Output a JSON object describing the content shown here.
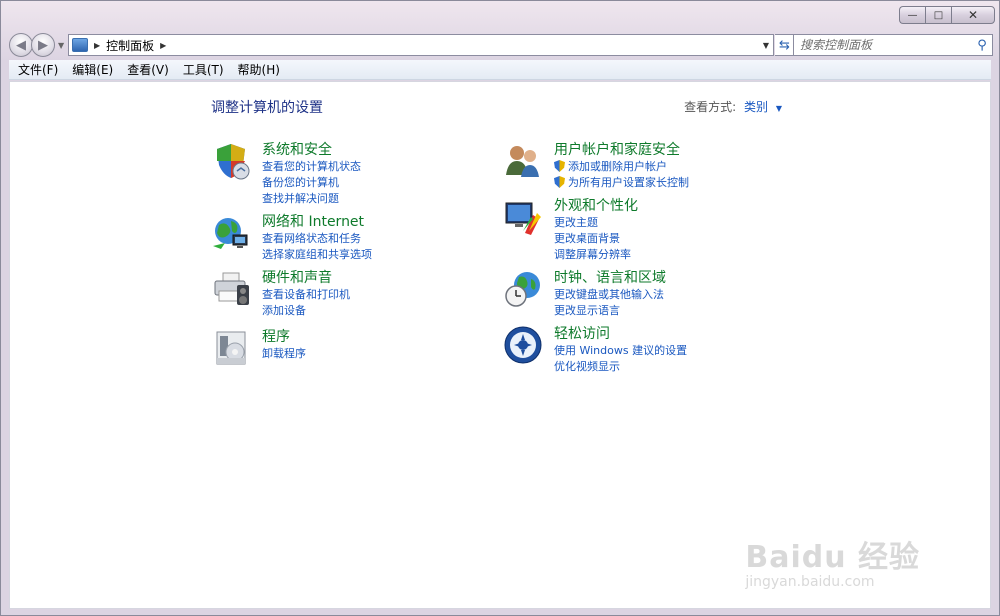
{
  "window": {
    "caption": {
      "minimize_glyph": "—",
      "maximize_glyph": "□",
      "close_glyph": "✕"
    }
  },
  "address": {
    "path": "控制面板",
    "icon": "control-panel-icon"
  },
  "search": {
    "placeholder": "搜索控制面板"
  },
  "menu": [
    {
      "label": "文件(F)"
    },
    {
      "label": "编辑(E)"
    },
    {
      "label": "查看(V)"
    },
    {
      "label": "工具(T)"
    },
    {
      "label": "帮助(H)"
    }
  ],
  "page": {
    "title": "调整计算机的设置",
    "view_by_label": "查看方式:",
    "view_by_value": "类别"
  },
  "categories_left": [
    {
      "title": "系统和安全",
      "icon": "system-security-icon",
      "links": [
        "查看您的计算机状态",
        "备份您的计算机",
        "查找并解决问题"
      ]
    },
    {
      "title": "网络和 Internet",
      "icon": "network-internet-icon",
      "links": [
        "查看网络状态和任务",
        "选择家庭组和共享选项"
      ]
    },
    {
      "title": "硬件和声音",
      "icon": "hardware-sound-icon",
      "links": [
        "查看设备和打印机",
        "添加设备"
      ]
    },
    {
      "title": "程序",
      "icon": "programs-icon",
      "links": [
        "卸载程序"
      ]
    }
  ],
  "categories_right": [
    {
      "title": "用户帐户和家庭安全",
      "icon": "user-accounts-icon",
      "links": [
        "添加或删除用户帐户",
        "为所有用户设置家长控制"
      ]
    },
    {
      "title": "外观和个性化",
      "icon": "appearance-icon",
      "links": [
        "更改主题",
        "更改桌面背景",
        "调整屏幕分辨率"
      ]
    },
    {
      "title": "时钟、语言和区域",
      "icon": "clock-language-icon",
      "links": [
        "更改键盘或其他输入法",
        "更改显示语言"
      ]
    },
    {
      "title": "轻松访问",
      "icon": "ease-of-access-icon",
      "links": [
        "使用 Windows 建议的设置",
        "优化视频显示"
      ]
    }
  ],
  "watermark": {
    "logo": "Baidu 经验",
    "url": "jingyan.baidu.com"
  }
}
